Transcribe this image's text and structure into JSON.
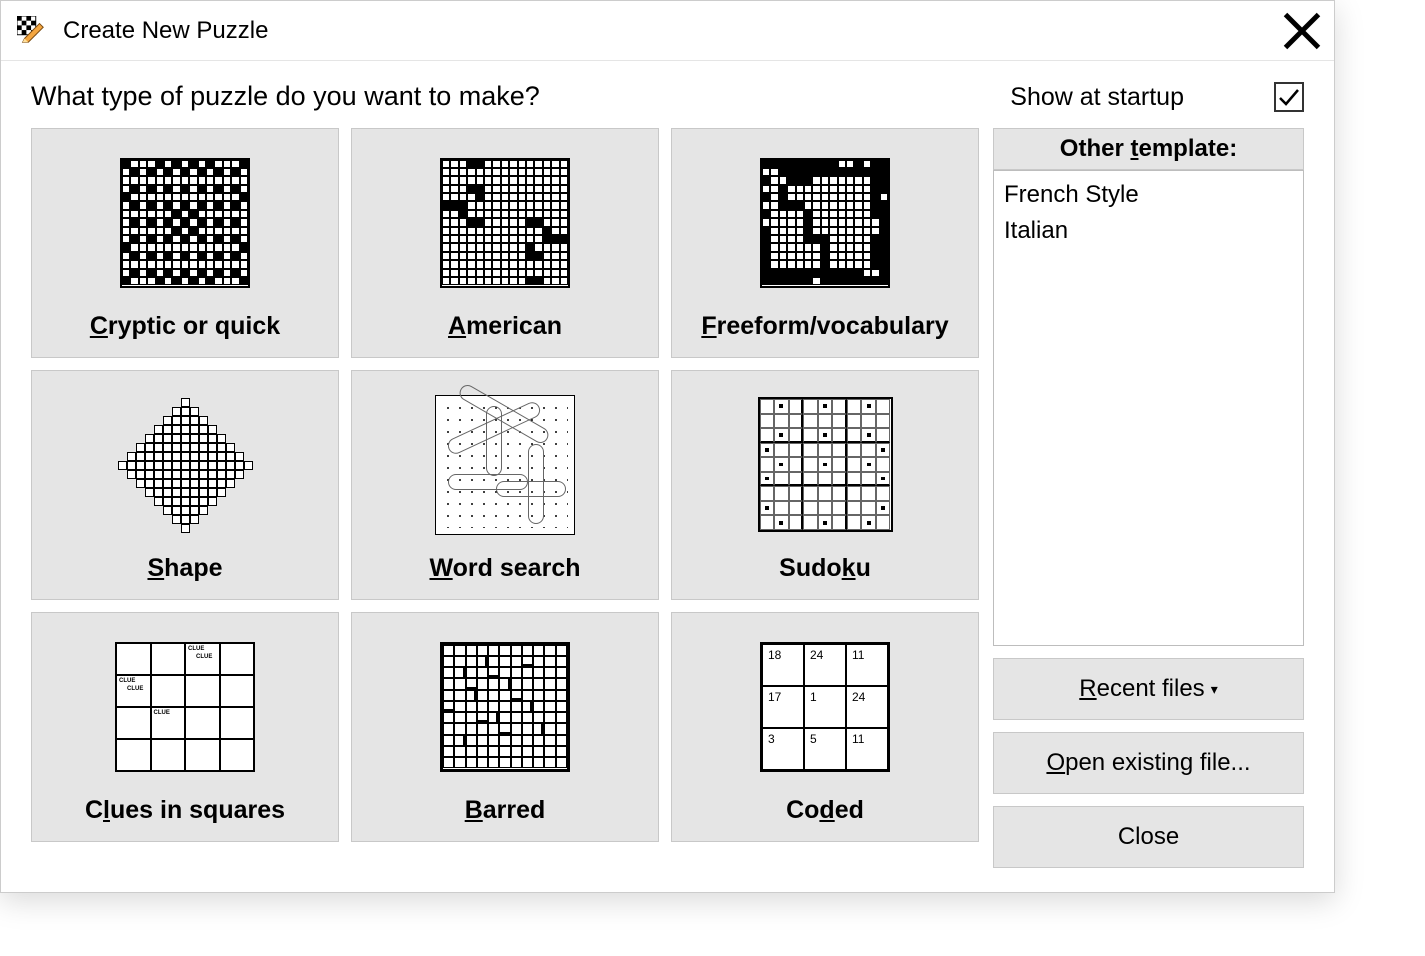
{
  "window": {
    "title": "Create New Puzzle"
  },
  "prompt": "What type of puzzle do you want to make?",
  "show_at_startup": {
    "label": "Show at startup",
    "checked": true
  },
  "tiles": [
    {
      "label_pre": "",
      "accel": "C",
      "label_post": "ryptic or quick"
    },
    {
      "label_pre": "",
      "accel": "A",
      "label_post": "merican"
    },
    {
      "label_pre": "",
      "accel": "F",
      "label_post": "reeform/vocabulary"
    },
    {
      "label_pre": "",
      "accel": "S",
      "label_post": "hape"
    },
    {
      "label_pre": "",
      "accel": "W",
      "label_post": "ord search"
    },
    {
      "label_pre": "Sudo",
      "accel": "k",
      "label_post": "u"
    },
    {
      "label_pre": "C",
      "accel": "l",
      "label_post": "ues in squares"
    },
    {
      "label_pre": "",
      "accel": "B",
      "label_post": "arred"
    },
    {
      "label_pre": "Co",
      "accel": "d",
      "label_post": "ed"
    }
  ],
  "other_template": {
    "header_pre": "Other ",
    "header_accel": "t",
    "header_post": "emplate:",
    "items": [
      "French Style",
      "Italian"
    ]
  },
  "side_buttons": {
    "recent_pre": "",
    "recent_accel": "R",
    "recent_post": "ecent files",
    "open_pre": "",
    "open_accel": "O",
    "open_post": "pen existing file...",
    "close": "Close"
  },
  "coded_numbers": [
    "18",
    "24",
    "11",
    "17",
    "1",
    "24",
    "3",
    "5",
    "11"
  ]
}
